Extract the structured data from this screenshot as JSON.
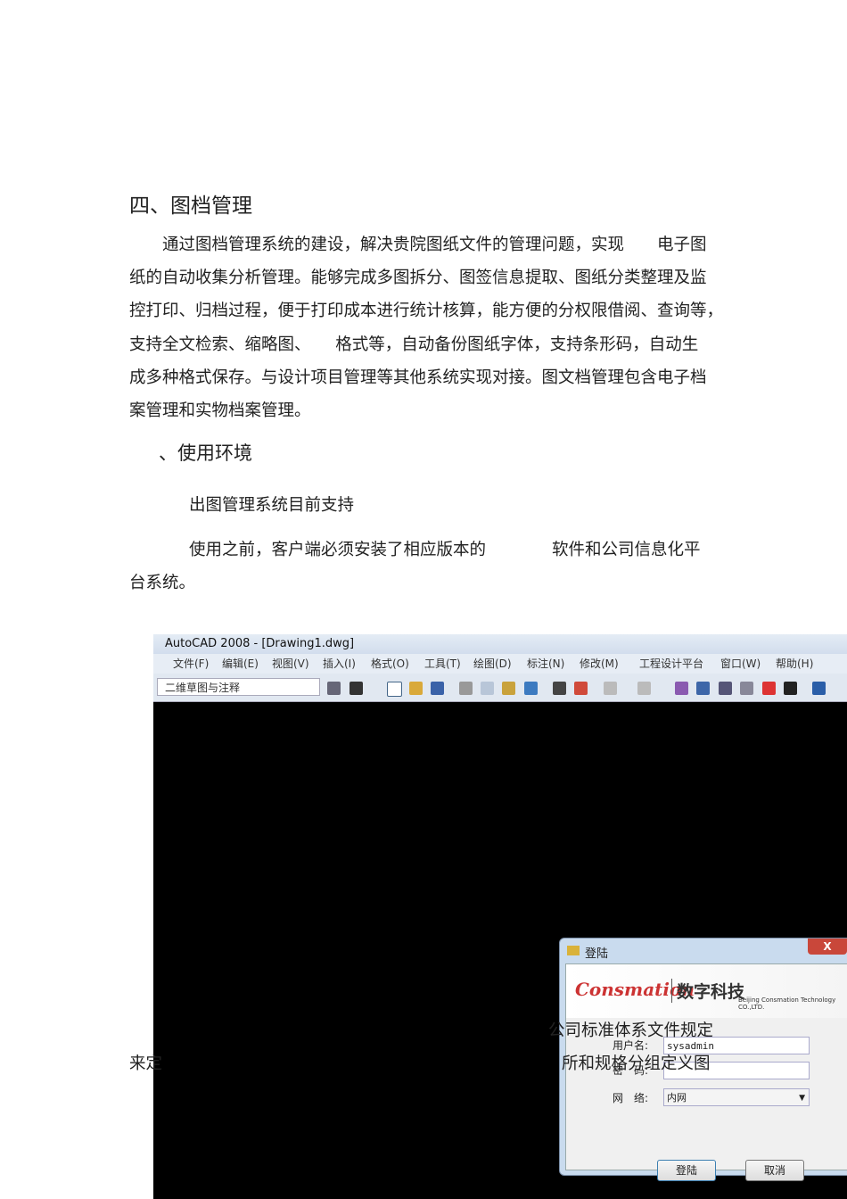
{
  "doc": {
    "heading": "四、图档管理",
    "para1": [
      "通过图档管理系统的建设，解决贵院图纸文件的管理问题，实现　　电子图",
      "纸的自动收集分析管理。能够完成多图拆分、图签信息提取、图纸分类整理及监",
      "控打印、归档过程，便于打印成本进行统计核算，能方便的分权限借阅、查询等，",
      "支持全文检索、缩略图、　　格式等，自动备份图纸字体，支持条形码，自动生",
      "成多种格式保存。与设计项目管理等其他系统实现对接。图文档管理包含电子档",
      "案管理和实物档案管理。"
    ],
    "sub": "、使用环境",
    "p2": "出图管理系统目前支持",
    "p3a": "使用之前，客户端必须安装了相应版本的　　　　软件和公司信息化平",
    "p3b": "台系统。",
    "overlay1": "公司标准体系文件规定",
    "overlay2": "来定",
    "overlay3": "所和规格分组定义图"
  },
  "app": {
    "title": "AutoCAD 2008 - [Drawing1.dwg]",
    "menu": [
      "文件(F)",
      "编辑(E)",
      "视图(V)",
      "插入(I)",
      "格式(O)",
      "工具(T)",
      "绘图(D)",
      "标注(N)",
      "修改(M)",
      "工程设计平台",
      "窗口(W)",
      "帮助(H)"
    ],
    "workspace": "二维草图与注释"
  },
  "login": {
    "title": "登陆",
    "close": "X",
    "logo": "Consmation",
    "logo_cn": "数字科技",
    "company": "Beijing Consmation Technology CO.,LTD.",
    "user_label": "用户名:",
    "user": "sysadmin",
    "pwd_label": "密　码:",
    "net_label": "网　络:",
    "net": "内网",
    "ok": "登陆",
    "cancel": "取消"
  }
}
